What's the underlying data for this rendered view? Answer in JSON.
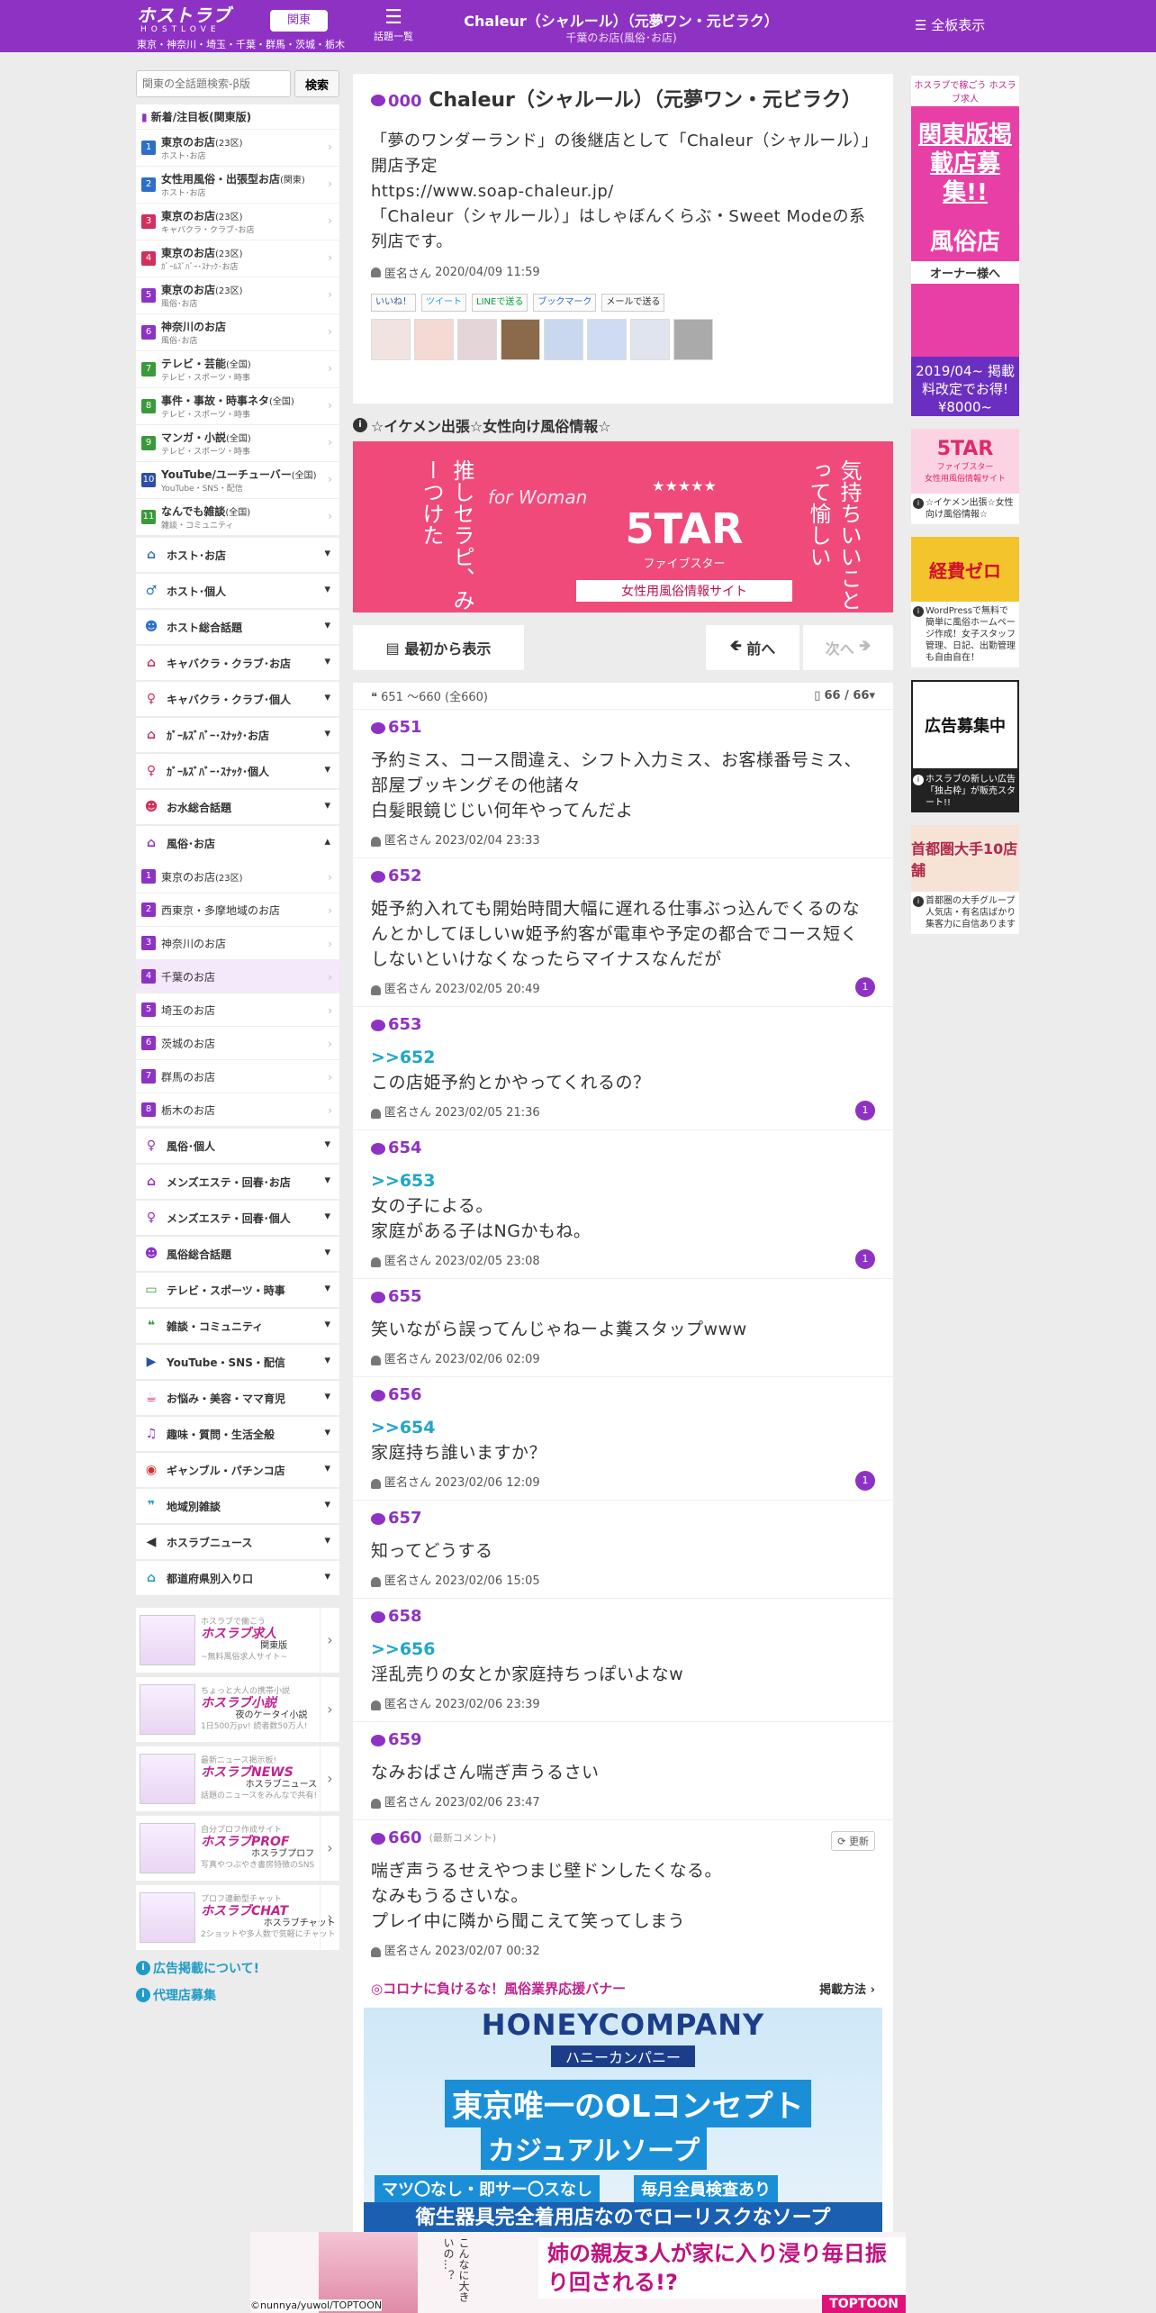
{
  "header": {
    "logo": "ホストラブ",
    "logo_sub": "HOSTLOVE",
    "region_button": "関東",
    "region_line": "東京・神奈川・埼玉・千葉・群馬・茨城・栃木",
    "topics_label": "話題一覧",
    "title": "Chaleur（シャルール）（元夢ワン・元ビラク）",
    "subtitle": "千葉のお店(風俗･お店)",
    "boards_button": "全板表示"
  },
  "left": {
    "search_placeholder": "関東の全話題検索-β版",
    "search_button": "検索",
    "new_panel_title": "新着/注目板(関東版)",
    "new_items": [
      {
        "num": "1",
        "color": "#2d6fc6",
        "title": "東京のお店",
        "tag": "(23区)",
        "sub": "ホスト･お店"
      },
      {
        "num": "2",
        "color": "#2d6fc6",
        "title": "女性用風俗・出張型お店",
        "tag": "(関東)",
        "sub": "ホスト･お店"
      },
      {
        "num": "3",
        "color": "#d0305a",
        "title": "東京のお店",
        "tag": "(23区)",
        "sub": "キャバクラ・クラブ･お店"
      },
      {
        "num": "4",
        "color": "#d0305a",
        "title": "東京のお店",
        "tag": "(23区)",
        "sub": "ｶﾞｰﾙｽﾞﾊﾞｰ･ｽﾅｯｸ･お店"
      },
      {
        "num": "5",
        "color": "#8e32c4",
        "title": "東京のお店",
        "tag": "(23区)",
        "sub": "風俗･お店"
      },
      {
        "num": "6",
        "color": "#8e32c4",
        "title": "神奈川のお店",
        "tag": "",
        "sub": "風俗･お店"
      },
      {
        "num": "7",
        "color": "#3a9a3a",
        "title": "テレビ・芸能",
        "tag": "(全国)",
        "sub": "テレビ・スポーツ・時事"
      },
      {
        "num": "8",
        "color": "#3a9a3a",
        "title": "事件・事故・時事ネタ",
        "tag": "(全国)",
        "sub": "テレビ・スポーツ・時事"
      },
      {
        "num": "9",
        "color": "#3a9a3a",
        "title": "マンガ・小説",
        "tag": "(全国)",
        "sub": "テレビ・スポーツ・時事"
      },
      {
        "num": "10",
        "color": "#2d4fa6",
        "title": "YouTube/ユーチューバー",
        "tag": "(全国)",
        "sub": "YouTube・SNS・配信"
      },
      {
        "num": "11",
        "color": "#3a9a3a",
        "title": "なんでも雑談",
        "tag": "(全国)",
        "sub": "雑談・コミュニティ"
      }
    ],
    "categories_a": [
      {
        "icon": "house-icon",
        "glyph": "⌂",
        "color": "#2d6fc6",
        "label": "ホスト･お店"
      },
      {
        "icon": "person-icon",
        "glyph": "♂",
        "color": "#2d6fc6",
        "label": "ホスト･個人"
      },
      {
        "icon": "group-icon",
        "glyph": "☻",
        "color": "#2d6fc6",
        "label": "ホスト総合話題"
      },
      {
        "icon": "house-icon",
        "glyph": "⌂",
        "color": "#d0305a",
        "label": "キャバクラ・クラブ･お店"
      },
      {
        "icon": "person-icon",
        "glyph": "♀",
        "color": "#d0305a",
        "label": "キャバクラ・クラブ･個人"
      },
      {
        "icon": "house-icon",
        "glyph": "⌂",
        "color": "#d0305a",
        "label": "ｶﾞｰﾙｽﾞﾊﾞｰ･ｽﾅｯｸ･お店"
      },
      {
        "icon": "person-icon",
        "glyph": "♀",
        "color": "#d0305a",
        "label": "ｶﾞｰﾙｽﾞﾊﾞｰ･ｽﾅｯｸ･個人"
      },
      {
        "icon": "group-icon",
        "glyph": "☻",
        "color": "#d0305a",
        "label": "お水総合話題"
      }
    ],
    "open_category": {
      "icon": "house-icon",
      "glyph": "⌂",
      "color": "#8e32c4",
      "label": "風俗･お店"
    },
    "sub_items": [
      {
        "num": "1",
        "label": "東京のお店",
        "tag": "(23区)"
      },
      {
        "num": "2",
        "label": "西東京・多摩地域のお店",
        "tag": ""
      },
      {
        "num": "3",
        "label": "神奈川のお店",
        "tag": ""
      },
      {
        "num": "4",
        "label": "千葉のお店",
        "tag": ""
      },
      {
        "num": "5",
        "label": "埼玉のお店",
        "tag": ""
      },
      {
        "num": "6",
        "label": "茨城のお店",
        "tag": ""
      },
      {
        "num": "7",
        "label": "群馬のお店",
        "tag": ""
      },
      {
        "num": "8",
        "label": "栃木のお店",
        "tag": ""
      }
    ],
    "categories_b": [
      {
        "icon": "person-icon",
        "glyph": "♀",
        "color": "#8e32c4",
        "label": "風俗･個人"
      },
      {
        "icon": "house-icon",
        "glyph": "⌂",
        "color": "#8e32c4",
        "label": "メンズエステ・回春･お店"
      },
      {
        "icon": "person-icon",
        "glyph": "♀",
        "color": "#8e32c4",
        "label": "メンズエステ・回春･個人"
      },
      {
        "icon": "group-icon",
        "glyph": "☻",
        "color": "#8e32c4",
        "label": "風俗総合話題"
      },
      {
        "icon": "tv-icon",
        "glyph": "▭",
        "color": "#3a9a3a",
        "label": "テレビ・スポーツ・時事"
      },
      {
        "icon": "chat-icon",
        "glyph": "❝",
        "color": "#3a9a3a",
        "label": "雑談・コミュニティ"
      },
      {
        "icon": "youtube-icon",
        "glyph": "▶",
        "color": "#2d4fa6",
        "label": "YouTube・SNS・配信"
      },
      {
        "icon": "cup-icon",
        "glyph": "☕",
        "color": "#d0307a",
        "label": "お悩み・美容・ママ育児"
      },
      {
        "icon": "music-icon",
        "glyph": "♫",
        "color": "#8e32c4",
        "label": "趣味・質問・生活全般"
      },
      {
        "icon": "dice-icon",
        "glyph": "◉",
        "color": "#d03030",
        "label": "ギャンブル・パチンコ店"
      },
      {
        "icon": "chat-icon",
        "glyph": "❞",
        "color": "#1f9cc6",
        "label": "地域別雑談"
      },
      {
        "icon": "megaphone-icon",
        "glyph": "◀",
        "color": "#333333",
        "label": "ホスラブニュース"
      },
      {
        "icon": "house-icon",
        "glyph": "⌂",
        "color": "#1f9cc6",
        "label": "都道府県別入り口"
      }
    ],
    "promos": [
      {
        "kicker": "ホスラブで働こう",
        "brand": "ホスラブ求人",
        "name": "関東版",
        "desc": "~無料風俗求人サイト~"
      },
      {
        "kicker": "ちょっと大人の携帯小説",
        "brand": "ホスラブ小説",
        "name": "夜のケータイ小説",
        "desc": "1日500万pv! 読者数50万人!"
      },
      {
        "kicker": "最新ニュース掲示板!",
        "brand": "ホスラブNEWS",
        "name": "ホスラブニュース",
        "desc": "話題のニュースをみんなで共有!"
      },
      {
        "kicker": "自分プロフ作成サイト",
        "brand": "ホスラブPROF",
        "name": "ホスラブプロフ",
        "desc": "写真やつぶやき書房特徴のSNS"
      },
      {
        "kicker": "プロフ連動型チャット",
        "brand": "ホスラブCHAT",
        "name": "ホスラブチャット",
        "desc": "2ショットや多人数で気軽にチャット"
      }
    ],
    "links": [
      "広告掲載について!",
      "代理店募集"
    ]
  },
  "topic": {
    "num": "000",
    "title": "Chaleur（シャルール）（元夢ワン・元ビラク）",
    "body": [
      "「夢のワンダーランド」の後継店として「Chaleur（シャルール）」開店予定",
      "https://www.soap-chaleur.jp/",
      "「Chaleur（シャルール）」はしゃぼんくらぶ・Sweet Modeの系列店です。"
    ],
    "author": "匿名さん",
    "date": "2020/04/09 11:59",
    "share": [
      "いいね！",
      "ツイート",
      "LINEで送る",
      "ブックマーク",
      "メールで送る"
    ]
  },
  "section_title": "☆イケメン出張☆女性向け風俗情報☆",
  "banner": {
    "left": "推しセラピ、みーつけた",
    "script": "for Woman",
    "brand": "5TAR",
    "brand_sub": "ファイブスター",
    "tagline": "女性用風俗情報サイト",
    "right": "気持ちいいことって愉しい"
  },
  "pager": {
    "first": "最初から表示",
    "prev": "前へ",
    "next": "次へ"
  },
  "count": {
    "range": "651 ～660",
    "total": "(全660)",
    "page": "66 / 66"
  },
  "comments": [
    {
      "num": "651",
      "reply": "",
      "body": [
        "予約ミス、コース間違え、シフト入力ミス、お客様番号ミス、部屋ブッキングその他諸々",
        "白髪眼鏡じじい何年やってんだよ"
      ],
      "author": "匿名さん",
      "date": "2023/02/04 23:33",
      "badge": ""
    },
    {
      "num": "652",
      "reply": "",
      "body": [
        "姫予約入れても開始時間大幅に遅れる仕事ぶっ込んでくるのなんとかしてほしいw姫予約客が電車や予定の都合でコース短くしないといけなくなったらマイナスなんだが"
      ],
      "author": "匿名さん",
      "date": "2023/02/05 20:49",
      "badge": "1"
    },
    {
      "num": "653",
      "reply": ">>652",
      "body": [
        "この店姫予約とかやってくれるの？"
      ],
      "author": "匿名さん",
      "date": "2023/02/05 21:36",
      "badge": "1"
    },
    {
      "num": "654",
      "reply": ">>653",
      "body": [
        "女の子による。",
        "家庭がある子はNGかもね。"
      ],
      "author": "匿名さん",
      "date": "2023/02/05 23:08",
      "badge": "1"
    },
    {
      "num": "655",
      "reply": "",
      "body": [
        "笑いながら誤ってんじゃねーよ糞スタップwww"
      ],
      "author": "匿名さん",
      "date": "2023/02/06 02:09",
      "badge": ""
    },
    {
      "num": "656",
      "reply": ">>654",
      "body": [
        "家庭持ち誰いますか？"
      ],
      "author": "匿名さん",
      "date": "2023/02/06 12:09",
      "badge": "1"
    },
    {
      "num": "657",
      "reply": "",
      "body": [
        "知ってどうする"
      ],
      "author": "匿名さん",
      "date": "2023/02/06 15:05",
      "badge": ""
    },
    {
      "num": "658",
      "reply": ">>656",
      "body": [
        "淫乱売りの女とか家庭持ちっぽいよなw"
      ],
      "author": "匿名さん",
      "date": "2023/02/06 23:39",
      "badge": ""
    },
    {
      "num": "659",
      "reply": "",
      "body": [
        "なみおばさん喘ぎ声うるさい"
      ],
      "author": "匿名さん",
      "date": "2023/02/06 23:47",
      "badge": ""
    }
  ],
  "latest": {
    "num": "660",
    "tag": "(最新コメント)",
    "refresh": "更新",
    "body": [
      "喘ぎ声うるせえやつまじ壁ドンしたくなる。",
      "なみもうるさいな。",
      "プレイ中に隣から聞こえて笑ってしまう"
    ],
    "author": "匿名さん",
    "date": "2023/02/07 00:32"
  },
  "corona": {
    "title": "◎コロナに負けるな！風俗業界応援バナー",
    "method": "掲載方法 ›"
  },
  "honey": {
    "name": "HONEYCOMPANY",
    "kana": "ハニーカンパニー",
    "line1": "東京唯一のOLコンセプト",
    "line2": "カジュアルソープ",
    "tag1": "マツ〇なし・即サー〇スなし",
    "tag2": "毎月全員検査あり",
    "foot": "衛生器具完全着用店なのでローリスクなソープ"
  },
  "right": {
    "ad1": {
      "kicker": "ホスラブで稼ごう ホスラブ求人",
      "title": "関東版掲載店募集!!",
      "sub": "風俗店",
      "owner": "オーナー様へ",
      "foot": "2019/04~ 掲載料改定でお得!¥8000~"
    },
    "ad2": {
      "img": "5TAR",
      "img_sub": "ファイブスター",
      "img_tag": "女性用風俗情報サイト",
      "caption": "☆イケメン出張☆女性向け風俗情報☆"
    },
    "ad3": {
      "img": "経費ゼロ",
      "caption": "WordPressで無料で簡単に風俗ホームページ作成！女子スタッフ管理、日記、出勤管理も自由自在！"
    },
    "ad4": {
      "img": "広告募集中",
      "caption": "ホスラブの新しい広告「独占枠」が販売スタート!!"
    },
    "ad5": {
      "img": "首都圏大手10店舗",
      "caption": "首都圏の大手グループ 人気店・有名店ばかり 集客力に自信あります"
    }
  },
  "bottom": {
    "speech": "こんなに大きいの…？",
    "msg": "姉の親友3人が家に入り浸り毎日振り回される!?",
    "brand": "TOPTOON",
    "copy": "©nunnya/yuwol/TOPTOON"
  }
}
